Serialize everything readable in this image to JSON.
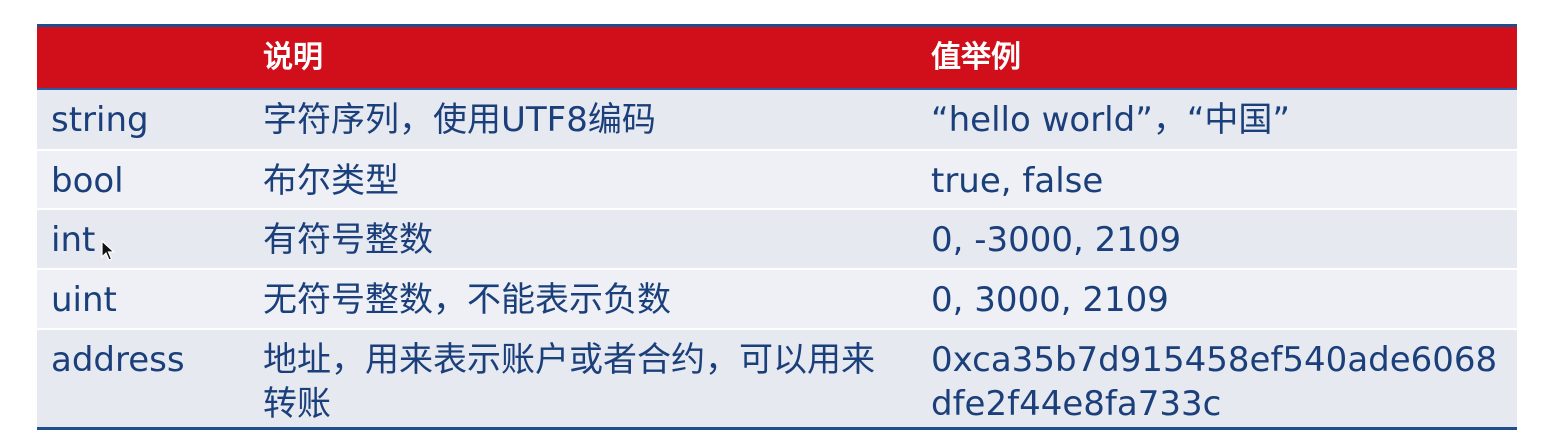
{
  "table": {
    "headers": [
      "",
      "说明",
      "值举例"
    ],
    "rows": [
      {
        "type": "string",
        "desc": "字符序列，使用UTF8编码",
        "example": " “hello world”，“中国”"
      },
      {
        "type": "bool",
        "desc": "布尔类型",
        "example": "true, false"
      },
      {
        "type": "int",
        "desc": "有符号整数",
        "example": "0, -3000, 2109"
      },
      {
        "type": "uint",
        "desc": "无符号整数，不能表示负数",
        "example": "0, 3000, 2109"
      },
      {
        "type": "address",
        "desc": "地址，用来表示账户或者合约，可以用来转账",
        "example": "0xca35b7d915458ef540ade6068dfe2f44e8fa733c"
      }
    ]
  },
  "colors": {
    "header_bg": "#d10f1a",
    "header_text": "#ffffff",
    "row_odd": "#e7e9f1",
    "row_even": "#eef0f5",
    "body_text": "#1a3f7a",
    "rule": "#1f4e8c"
  },
  "icons": {
    "cursor": "mouse-pointer-icon"
  }
}
